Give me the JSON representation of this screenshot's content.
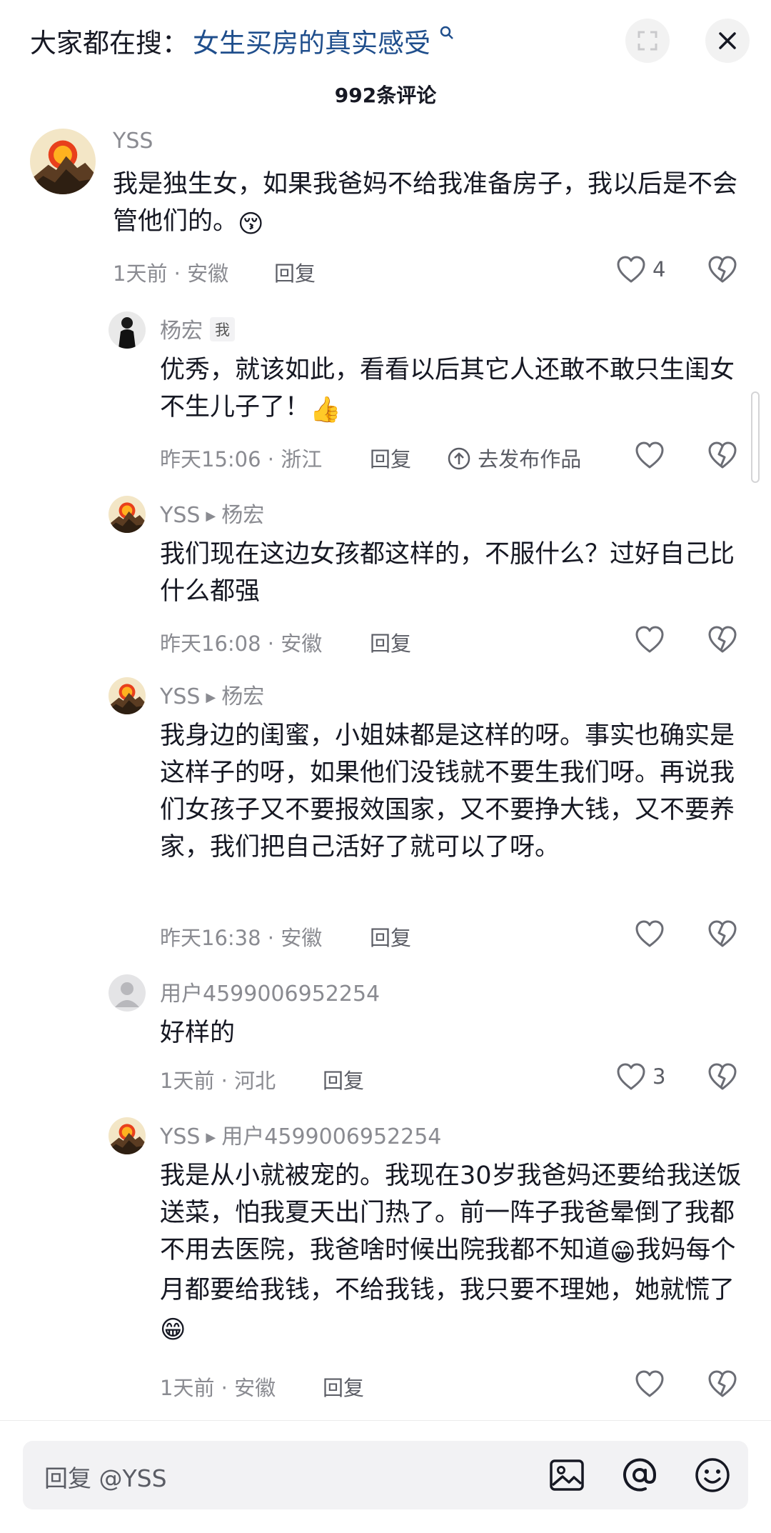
{
  "header": {
    "search_prefix": "大家都在搜：",
    "search_term": "女生买房的真实感受",
    "comment_count": "992条评论"
  },
  "comments": [
    {
      "user": "YSS",
      "text": "我是独生女，如果我爸妈不给我准备房子，我以后是不会管他们的。",
      "emoji": "😚",
      "time": "1天前",
      "location": "安徽",
      "reply_label": "回复",
      "likes": "4"
    },
    {
      "user": "杨宏",
      "me_tag": "我",
      "text": "优秀，就该如此，看看以后其它人还敢不敢只生闺女不生儿子了！",
      "emoji": "👍",
      "time": "昨天15:06",
      "location": "浙江",
      "reply_label": "回复",
      "publish_label": "去发布作品",
      "likes": ""
    },
    {
      "user": "YSS",
      "reply_to": "杨宏",
      "text": "我们现在这边女孩都这样的，不服什么？过好自己比什么都强",
      "time": "昨天16:08",
      "location": "安徽",
      "reply_label": "回复",
      "likes": ""
    },
    {
      "user": "YSS",
      "reply_to": "杨宏",
      "text": "我身边的闺蜜，小姐妹都是这样的呀。事实也确实是这样子的呀，如果他们没钱就不要生我们呀。再说我们女孩子又不要报效国家，又不要挣大钱，又不要养家，我们把自己活好了就可以了呀。",
      "time": "昨天16:38",
      "location": "安徽",
      "reply_label": "回复",
      "likes": ""
    },
    {
      "user": "用户4599006952254",
      "text": "好样的",
      "time": "1天前",
      "location": "河北",
      "reply_label": "回复",
      "likes": "3"
    },
    {
      "user": "YSS",
      "reply_to": "用户4599006952254",
      "text_part1": "我是从小就被宠的。我现在30岁我爸妈还要给我送饭送菜，怕我夏天出门热了。前一阵子我爸晕倒了我都不用去医院，我爸啥时候出院我都不知道",
      "text_part2": "我妈每个月都要给我钱，不给我钱，我只要不理她，她就慌了",
      "emoji": "😁",
      "time": "1天前",
      "location": "安徽",
      "reply_label": "回复",
      "likes": ""
    }
  ],
  "footer": {
    "input_placeholder": "回复 @YSS"
  },
  "icons": {
    "like": "heart-outline-icon",
    "dislike": "broken-heart-icon",
    "image": "image-icon",
    "mention": "at-sign-icon",
    "emoji": "smiley-icon",
    "close": "close-icon",
    "expand": "expand-icon"
  }
}
